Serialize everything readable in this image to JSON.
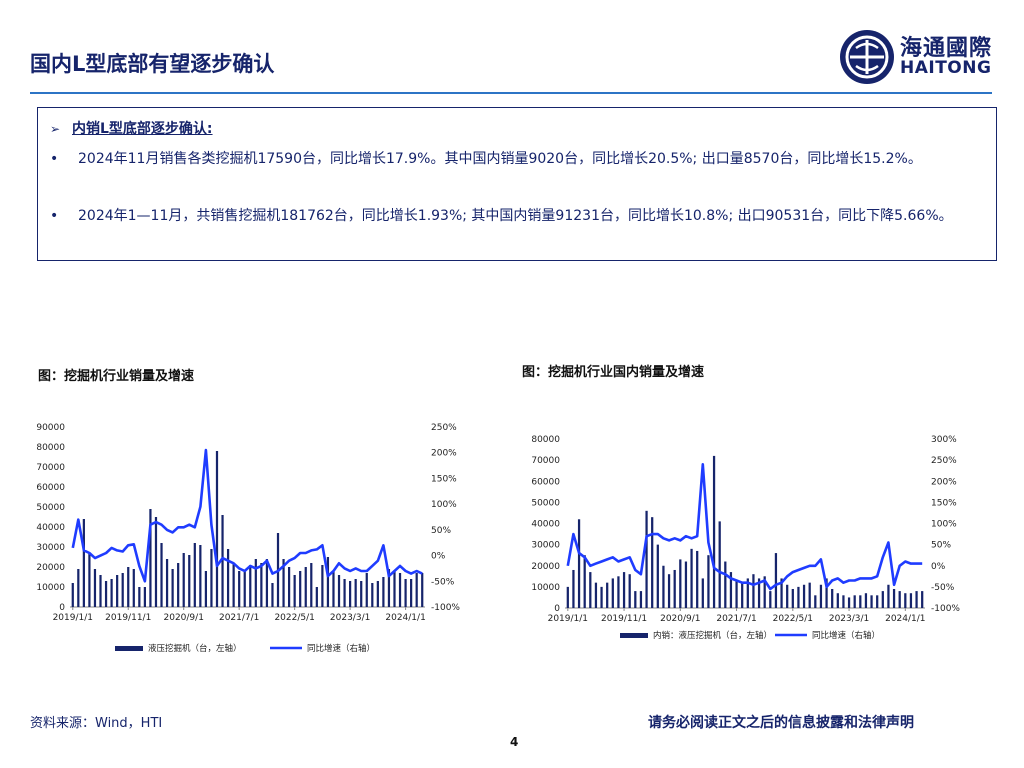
{
  "header": {
    "title": "国内L型底部有望逐步确认",
    "logo_cn": "海通國際",
    "logo_en": "HAITONG"
  },
  "summary": {
    "heading": "内销L型底部逐步确认:",
    "bullets": [
      "2024年11月销售各类挖掘机17590台，同比增长17.9%。其中国内销量9020台，同比增长20.5%; 出口量8570台，同比增长15.2%。",
      "2024年1—11月，共销售挖掘机181762台，同比增长1.93%; 其中国内销量91231台，同比增长10.8%; 出口90531台，同比下降5.66%。"
    ]
  },
  "chart_titles": {
    "left": "图：挖掘机行业销量及增速",
    "right": "图：挖掘机行业国内销量及增速"
  },
  "colors": {
    "bar": "#16246b",
    "line": "#1f3cff",
    "accent": "#2c74c5"
  },
  "chart_data": [
    {
      "type": "bar",
      "combo": "bar+line",
      "x_ticks": [
        "2019/1/1",
        "2019/11/1",
        "2020/9/1",
        "2021/7/1",
        "2022/5/1",
        "2023/3/1",
        "2024/1/1"
      ],
      "x_tick_index": [
        0,
        10,
        20,
        30,
        40,
        50,
        60
      ],
      "ylim_left": [
        0,
        90000
      ],
      "yticks_left": [
        "0",
        "10000",
        "20000",
        "30000",
        "40000",
        "50000",
        "60000",
        "70000",
        "80000",
        "90000"
      ],
      "ylim_right": [
        -100,
        250
      ],
      "yticks_right": [
        "-100%",
        "-50%",
        "0%",
        "50%",
        "100%",
        "150%",
        "200%",
        "250%"
      ],
      "series": [
        {
          "name": "液压挖掘机（台，左轴）",
          "kind": "bar",
          "axis": "left",
          "values": [
            12000,
            19000,
            44000,
            27000,
            19000,
            16000,
            13000,
            14000,
            16000,
            17000,
            20000,
            19000,
            10000,
            10000,
            49000,
            45000,
            32000,
            24000,
            19000,
            22000,
            27000,
            26000,
            32000,
            31000,
            18000,
            29000,
            78000,
            46000,
            29000,
            22000,
            18000,
            18000,
            21000,
            24000,
            22000,
            24000,
            12000,
            37000,
            24000,
            20000,
            16000,
            18000,
            20000,
            22000,
            10000,
            21000,
            25000,
            18000,
            16000,
            14000,
            13000,
            14000,
            13000,
            17000,
            12000,
            13000,
            15000,
            19000,
            18000,
            17000,
            14000,
            14000,
            17000,
            17000
          ]
        },
        {
          "name": "同比增速（右轴）",
          "kind": "line",
          "axis": "right",
          "values": [
            15,
            70,
            10,
            5,
            -5,
            0,
            5,
            15,
            10,
            8,
            20,
            22,
            -20,
            -50,
            60,
            65,
            60,
            50,
            45,
            55,
            55,
            60,
            55,
            95,
            205,
            60,
            -20,
            -5,
            -10,
            -15,
            -25,
            -30,
            -20,
            -25,
            -20,
            -10,
            -35,
            -30,
            -20,
            -10,
            -5,
            5,
            5,
            10,
            12,
            20,
            -40,
            -30,
            -15,
            -25,
            -30,
            -25,
            -30,
            -30,
            -20,
            -10,
            20,
            -40,
            -30,
            -20,
            -30,
            -35,
            -30,
            -35
          ]
        }
      ]
    },
    {
      "type": "bar",
      "combo": "bar+line",
      "x_ticks": [
        "2019/1/1",
        "2019/11/1",
        "2020/9/1",
        "2021/7/1",
        "2022/5/1",
        "2023/3/1",
        "2024/1/1"
      ],
      "x_tick_index": [
        0,
        10,
        20,
        30,
        40,
        50,
        60
      ],
      "ylim_left": [
        0,
        80000
      ],
      "yticks_left": [
        "0",
        "10000",
        "20000",
        "30000",
        "40000",
        "50000",
        "60000",
        "70000",
        "80000"
      ],
      "ylim_right": [
        -100,
        300
      ],
      "yticks_right": [
        "-100%",
        "-50%",
        "0%",
        "50%",
        "100%",
        "150%",
        "200%",
        "250%",
        "300%"
      ],
      "series": [
        {
          "name": "内销：液压挖掘机（台，左轴）",
          "kind": "bar",
          "axis": "right_placeholder",
          "values": [
            10000,
            18000,
            42000,
            25000,
            17000,
            12000,
            10000,
            12000,
            14000,
            15000,
            17000,
            16000,
            8000,
            8000,
            46000,
            43000,
            30000,
            20000,
            16000,
            18000,
            23000,
            22000,
            28000,
            27000,
            14000,
            25000,
            72000,
            41000,
            22000,
            17000,
            13000,
            12000,
            14000,
            16000,
            14000,
            15000,
            8000,
            26000,
            14000,
            11000,
            9000,
            10000,
            11000,
            12000,
            6000,
            11000,
            14000,
            9000,
            7000,
            6000,
            5000,
            6000,
            6000,
            7000,
            6000,
            6000,
            8000,
            11000,
            9000,
            8000,
            7000,
            7000,
            8000,
            8000
          ]
        },
        {
          "name": "同比增速（右轴）",
          "kind": "line",
          "axis": "right",
          "values": [
            0,
            75,
            30,
            20,
            0,
            5,
            10,
            15,
            20,
            10,
            15,
            20,
            -10,
            -20,
            70,
            75,
            75,
            65,
            60,
            65,
            60,
            70,
            65,
            70,
            240,
            55,
            -5,
            -15,
            -20,
            -30,
            -35,
            -40,
            -40,
            -45,
            -40,
            -35,
            -55,
            -45,
            -40,
            -25,
            -15,
            -10,
            -5,
            0,
            0,
            15,
            -50,
            -35,
            -30,
            -40,
            -35,
            -35,
            -30,
            -30,
            -30,
            -25,
            20,
            55,
            -45,
            0,
            10,
            5,
            5,
            5
          ]
        }
      ]
    }
  ],
  "footer": {
    "source": "资料来源：Wind，HTI",
    "disclaimer": "请务必阅读正文之后的信息披露和法律声明",
    "page_number": "4"
  }
}
